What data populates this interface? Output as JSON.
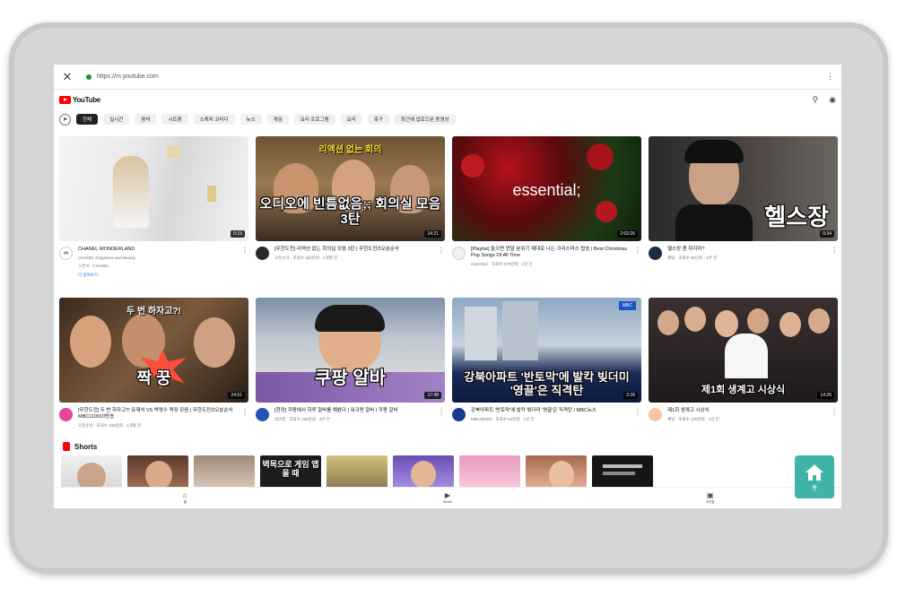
{
  "browser": {
    "url": "https://m.youtube.com",
    "close_icon": "close-icon",
    "menu_icon": "kebab-icon"
  },
  "header": {
    "brand": "YouTube",
    "search_icon": "search-icon",
    "account_icon": "account-icon"
  },
  "chips": [
    "전체",
    "실시간",
    "음악",
    "시트콤",
    "스케치 코미디",
    "뉴스",
    "게임",
    "요리 프로그램",
    "요리",
    "축구",
    "최근에 업로드된 동영상"
  ],
  "videos": [
    {
      "title": "CHANEL WONDERLAND",
      "channel": "CHANEL Fragrance and Beauty",
      "extra": "스폰서 · CHANEL",
      "link": "더 알아보기",
      "duration": "0:15",
      "thumb_text": "",
      "thumb_sub": ""
    },
    {
      "title": "[무한도전] 리액션 없는 회의실 모음 3탄 | 무한도전⏱오분순삭",
      "channel": "오분순삭 · 조회수 320만회 · 1개월 전",
      "extra": "",
      "link": "",
      "duration": "14:21",
      "thumb_text": "오디오에 빈틈없음;; 회의실 모음 3탄",
      "thumb_sub": "리액션 없는 회의"
    },
    {
      "title": "[Playlist] 들으면 연말 분위기 제대로 나는 크리스마스 팝송 | Best Christmas Pop Songs Of All Time",
      "channel": "essential; · 조회수 270만회 · 1년 전",
      "extra": "",
      "link": "",
      "duration": "2:02:26",
      "thumb_text": "essential;",
      "thumb_sub": ""
    },
    {
      "title": "헬스장 좀 하지마?",
      "channel": "채널 · 조회수 56만회 · 2주 전",
      "extra": "",
      "link": "",
      "duration": "0:34",
      "thumb_text": "헬스장",
      "thumb_sub": ""
    },
    {
      "title": "[무한도전] 두 번 하자고?! 유재석 VS 박명수 짝꿍 모음 | 무한도전⏱오분순삭 MBC110910방송",
      "channel": "오분순삭 · 조회수 165만회 · 1개월 전",
      "extra": "",
      "link": "",
      "duration": "24:51",
      "thumb_text": "짝 꿍",
      "thumb_sub": "두 번 하자고?!"
    },
    {
      "title": "[현장] 쿠팡에서 하루 알바를 해봤다 | 워크맨 알바 | 쿠팡 알바",
      "channel": "워크맨 · 조회수 425만회 · 3년 전",
      "extra": "",
      "link": "",
      "duration": "17:48",
      "thumb_text": "쿠팡 알바",
      "thumb_sub": ""
    },
    {
      "title": "강북아파트 '반토막'에 발칵 빚더미 '영끌'은 직격탄 / MBC뉴스",
      "channel": "MBCNEWS · 조회수 54만회 · 1일 전",
      "extra": "",
      "link": "",
      "duration": "2:26",
      "thumb_text": "강북아파트 '반토막'에 발칵 빚더미 '영끌'은 직격탄",
      "thumb_sub": ""
    },
    {
      "title": "제1회 생계고 시상식",
      "channel": "채널 · 조회수 120만회 · 1년 전",
      "extra": "",
      "link": "",
      "duration": "14:26",
      "thumb_text": "제1회 생계고 시상식",
      "thumb_sub": ""
    }
  ],
  "shorts": {
    "label": "Shorts",
    "items": [
      "",
      "",
      "",
      "벽목으로 게임 앱을 때",
      "",
      "",
      "",
      "",
      ""
    ]
  },
  "bottom_nav": [
    {
      "label": "홈",
      "icon": "home-icon"
    },
    {
      "label": "Shorts",
      "icon": "shorts-icon"
    },
    {
      "label": "보관함",
      "icon": "library-icon"
    }
  ],
  "fab": {
    "label": "홈",
    "icon": "home-icon"
  },
  "colors": {
    "brand": "#ff0000",
    "fab": "#3fb3a8",
    "link": "#1a66d6"
  }
}
